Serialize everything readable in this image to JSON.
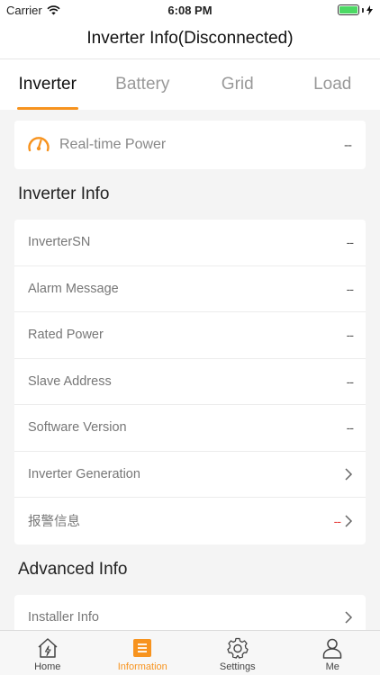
{
  "status_bar": {
    "carrier": "Carrier",
    "time": "6:08 PM"
  },
  "nav": {
    "title": "Inverter Info(Disconnected)"
  },
  "tabs": [
    {
      "label": "Inverter",
      "active": true
    },
    {
      "label": "Battery",
      "active": false
    },
    {
      "label": "Grid",
      "active": false
    },
    {
      "label": "Load",
      "active": false
    }
  ],
  "realtime": {
    "label": "Real-time Power",
    "value": "--",
    "icon": "gauge-icon"
  },
  "inverter_info": {
    "title": "Inverter Info",
    "rows": [
      {
        "label": "InverterSN",
        "value": "--"
      },
      {
        "label": "Alarm Message",
        "value": "--"
      },
      {
        "label": "Rated Power",
        "value": "--"
      },
      {
        "label": "Slave Address",
        "value": "--"
      },
      {
        "label": "Software Version",
        "value": "--"
      },
      {
        "label": "Inverter Generation",
        "value": ""
      },
      {
        "label": "报警信息",
        "value": "--"
      }
    ]
  },
  "advanced_info": {
    "title": "Advanced Info",
    "rows": [
      {
        "label": "Installer Info"
      }
    ]
  },
  "tab_bar": {
    "items": [
      {
        "label": "Home",
        "icon": "home-icon"
      },
      {
        "label": "Information",
        "icon": "list-icon",
        "active": true
      },
      {
        "label": "Settings",
        "icon": "gear-icon"
      },
      {
        "label": "Me",
        "icon": "person-icon"
      }
    ]
  },
  "colors": {
    "accent": "#f7931e",
    "alarm": "#e64340"
  }
}
